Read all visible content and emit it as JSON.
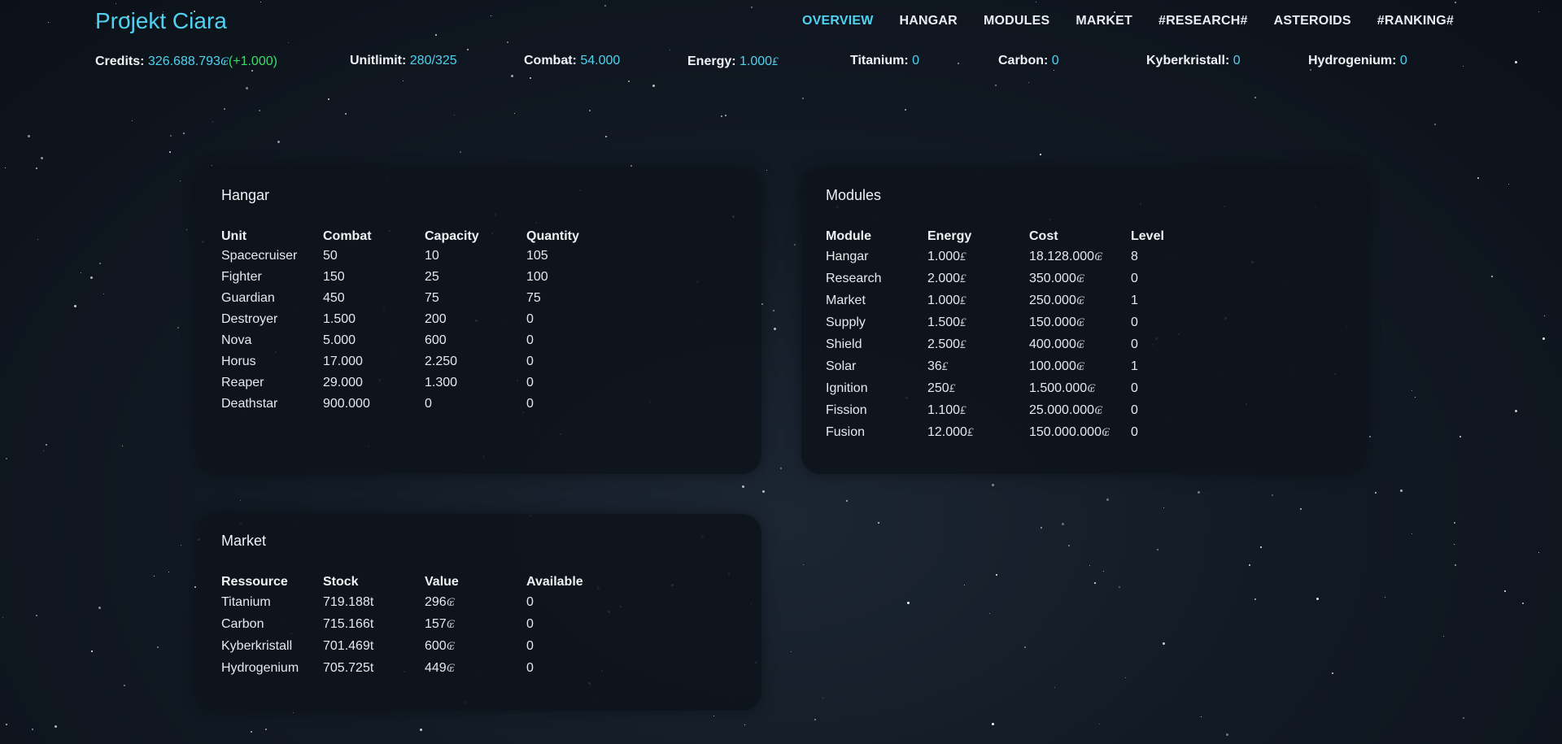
{
  "app": {
    "title": "Projekt Ciara"
  },
  "nav": [
    {
      "label": "OVERVIEW",
      "active": true
    },
    {
      "label": "HANGAR"
    },
    {
      "label": "MODULES"
    },
    {
      "label": "MARKET"
    },
    {
      "label": "#RESEARCH#"
    },
    {
      "label": "ASTEROIDS"
    },
    {
      "label": "#RANKING#"
    }
  ],
  "resources": {
    "credits": {
      "label": "Credits:",
      "value": "326.688.793",
      "delta": "(+1.000)"
    },
    "unitlimit": {
      "label": "Unitlimit:",
      "value": "280/325"
    },
    "combat": {
      "label": "Combat:",
      "value": "54.000"
    },
    "energy": {
      "label": "Energy:",
      "value": "1.000"
    },
    "titanium": {
      "label": "Titanium:",
      "value": "0"
    },
    "carbon": {
      "label": "Carbon:",
      "value": "0"
    },
    "kyberkristall": {
      "label": "Kyberkristall:",
      "value": "0"
    },
    "hydrogenium": {
      "label": "Hydrogenium:",
      "value": "0"
    }
  },
  "symbols": {
    "credit": "₢",
    "energy": "₤"
  },
  "hangar": {
    "title": "Hangar",
    "headers": [
      "Unit",
      "Combat",
      "Capacity",
      "Quantity"
    ],
    "rows": [
      [
        "Spacecruiser",
        "50",
        "10",
        "105"
      ],
      [
        "Fighter",
        "150",
        "25",
        "100"
      ],
      [
        "Guardian",
        "450",
        "75",
        "75"
      ],
      [
        "Destroyer",
        "1.500",
        "200",
        "0"
      ],
      [
        "Nova",
        "5.000",
        "600",
        "0"
      ],
      [
        "Horus",
        "17.000",
        "2.250",
        "0"
      ],
      [
        "Reaper",
        "29.000",
        "1.300",
        "0"
      ],
      [
        "Deathstar",
        "900.000",
        "0",
        "0"
      ]
    ]
  },
  "modules": {
    "title": "Modules",
    "headers": [
      "Module",
      "Energy",
      "Cost",
      "Level"
    ],
    "rows": [
      [
        "Hangar",
        "1.000",
        "18.128.000",
        "8"
      ],
      [
        "Research",
        "2.000",
        "350.000",
        "0"
      ],
      [
        "Market",
        "1.000",
        "250.000",
        "1"
      ],
      [
        "Supply",
        "1.500",
        "150.000",
        "0"
      ],
      [
        "Shield",
        "2.500",
        "400.000",
        "0"
      ],
      [
        "Solar",
        "36",
        "100.000",
        "1"
      ],
      [
        "Ignition",
        "250",
        "1.500.000",
        "0"
      ],
      [
        "Fission",
        "1.100",
        "25.000.000",
        "0"
      ],
      [
        "Fusion",
        "12.000",
        "150.000.000",
        "0"
      ]
    ]
  },
  "market": {
    "title": "Market",
    "headers": [
      "Ressource",
      "Stock",
      "Value",
      "Available"
    ],
    "rows": [
      [
        "Titanium",
        "719.188t",
        "296",
        "0"
      ],
      [
        "Carbon",
        "715.166t",
        "157",
        "0"
      ],
      [
        "Kyberkristall",
        "701.469t",
        "600",
        "0"
      ],
      [
        "Hydrogenium",
        "705.725t",
        "449",
        "0"
      ]
    ]
  },
  "colors": {
    "accent": "#4fd2f0",
    "positive": "#3ddc6a",
    "card": "#0e131a",
    "background": "#121a24"
  }
}
